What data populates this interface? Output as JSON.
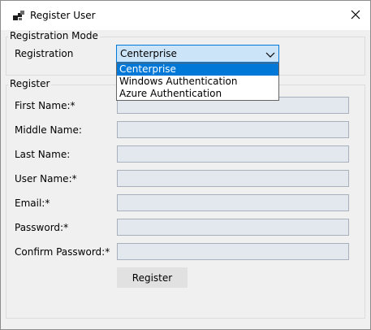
{
  "window": {
    "title": "Register User"
  },
  "registration_mode": {
    "group_title": "Registration Mode",
    "label": "Registration",
    "selected": "Centerprise",
    "options": [
      "Centerprise",
      "Windows Authentication",
      "Azure Authentication"
    ]
  },
  "register": {
    "group_title": "Register",
    "fields": {
      "first_name": {
        "label": "First Name:*",
        "value": ""
      },
      "middle_name": {
        "label": "Middle Name:",
        "value": ""
      },
      "last_name": {
        "label": "Last Name:",
        "value": ""
      },
      "user_name": {
        "label": "User Name:*",
        "value": ""
      },
      "email": {
        "label": "Email:*",
        "value": ""
      },
      "password": {
        "label": "Password:*",
        "value": ""
      },
      "confirm_password": {
        "label": "Confirm Password:*",
        "value": ""
      }
    },
    "button_label": "Register"
  },
  "colors": {
    "accent": "#0078d7",
    "client_background": "#f0f0f0",
    "input_background": "#e3e8ef",
    "combo_background": "#cce4f7"
  }
}
